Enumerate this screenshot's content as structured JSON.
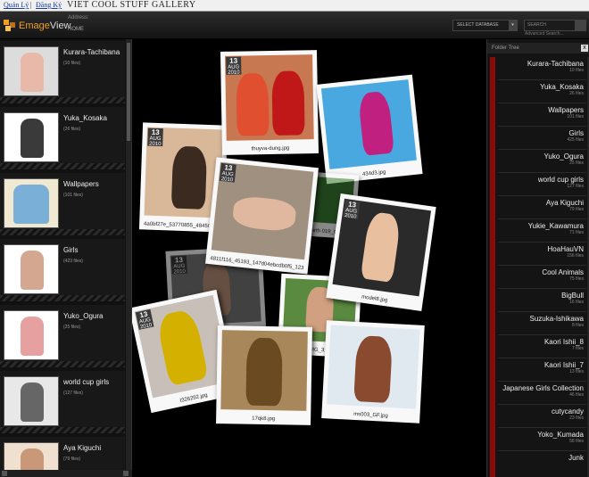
{
  "topbar": {
    "link_manage": "Quản Lý",
    "separator": "|",
    "link_register": "Đăng Ký",
    "site_title": "VIET COOL STUFF GALLERY"
  },
  "header": {
    "logo_emage": "Emage",
    "logo_view": "View",
    "address_label": "Address:",
    "address_value": "HOME",
    "select_database": "SELECT DATABASE",
    "search_placeholder": "SEARCH",
    "advanced_search": "Advanced Search..."
  },
  "left_folders": [
    {
      "name": "Kurara-Tachibana",
      "count": "(10 files)",
      "color": "#e8b8a8"
    },
    {
      "name": "Yuka_Kosaka",
      "count": "(26 files)",
      "color": "#3a3a3a"
    },
    {
      "name": "Wallpapers",
      "count": "(101 files)",
      "color": "#7ab0d8"
    },
    {
      "name": "Girls",
      "count": "(423 files)",
      "color": "#d4a890"
    },
    {
      "name": "Yuko_Ogura",
      "count": "(25 files)",
      "color": "#e6a0a0"
    },
    {
      "name": "world cup girls",
      "count": "(127 files)",
      "color": "#666666"
    },
    {
      "name": "Aya Kiguchi",
      "count": "(79 files)",
      "color": "#c89878"
    }
  ],
  "gallery": [
    {
      "caption": "thuyva-dung.jpg",
      "day": "13",
      "month": "AUG",
      "year": "2010"
    },
    {
      "caption": "4a0bf27e_53770855_484507b6",
      "day": "13",
      "month": "AUG",
      "year": "2010"
    },
    {
      "caption": "434d3.jpg",
      "day": "",
      "month": "",
      "year": ""
    },
    {
      "caption": "4811f116_45193_147d04ebcdb0f5_123",
      "day": "13",
      "month": "AUG",
      "year": "2010"
    },
    {
      "caption": "Earth 019_Cit",
      "day": "",
      "month": "",
      "year": ""
    },
    {
      "caption": "model8.jpg",
      "day": "13",
      "month": "AUG",
      "year": "2010"
    },
    {
      "caption": "",
      "day": "13",
      "month": "AUG",
      "year": "2010"
    },
    {
      "caption": "IMG_31",
      "day": "",
      "month": "",
      "year": ""
    },
    {
      "caption": "t326292.jpg",
      "day": "13",
      "month": "AUG",
      "year": "2010"
    },
    {
      "caption": "17qk8.jpg",
      "day": "",
      "month": "",
      "year": ""
    },
    {
      "caption": "ms003_GF.jpg",
      "day": "",
      "month": "",
      "year": ""
    }
  ],
  "folder_tree": {
    "title": "Folder Tree",
    "close": "x",
    "items": [
      {
        "name": "Kurara-Tachibana",
        "count": "10 files"
      },
      {
        "name": "Yuka_Kosaka",
        "count": "26 files"
      },
      {
        "name": "Wallpapers",
        "count": "101 files"
      },
      {
        "name": "Girls",
        "count": "425 files"
      },
      {
        "name": "Yuko_Ogura",
        "count": "25 files"
      },
      {
        "name": "world cup girls",
        "count": "127 files"
      },
      {
        "name": "Aya Kiguchi",
        "count": "79 files"
      },
      {
        "name": "Yukie_Kawamura",
        "count": "71 files"
      },
      {
        "name": "HoaHauVN",
        "count": "156 files"
      },
      {
        "name": "Cool Animals",
        "count": "75 files"
      },
      {
        "name": "BigBull",
        "count": "16 files"
      },
      {
        "name": "Suzuka-Ishikawa",
        "count": "8 files"
      },
      {
        "name": "Kaori Ishii_8",
        "count": "7 files"
      },
      {
        "name": "Kaori Ishii_7",
        "count": "13 files"
      },
      {
        "name": "Japanese Girls Collection",
        "count": "46 files"
      },
      {
        "name": "cutycandy",
        "count": "23 files"
      },
      {
        "name": "Yoko_Kumada",
        "count": "58 files"
      },
      {
        "name": "Junk",
        "count": ""
      }
    ]
  },
  "colors": {
    "accent": "#f0a020",
    "tree_rail": "#8a0a0a"
  }
}
